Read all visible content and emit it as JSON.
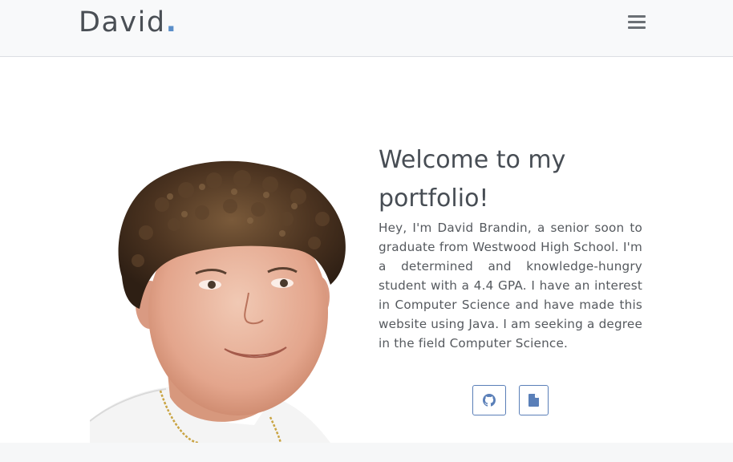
{
  "navbar": {
    "brand_name": "David",
    "brand_dot": ".",
    "menu_icon": "hamburger-icon"
  },
  "hero": {
    "photo_alt": "Portrait photo of David",
    "title": "Welcome to my portfolio!",
    "bio": "Hey, I'm David Brandin, a senior soon to graduate from Westwood High School. I'm a determined and knowledge-hungry student with a 4.4 GPA. I have an interest in Computer Science and have made this website using Java. I am seeking a degree in the field Computer Science.",
    "buttons": [
      {
        "icon": "github-icon"
      },
      {
        "icon": "document-icon"
      }
    ]
  },
  "colors": {
    "accent": "#5b8fc9",
    "button_border": "#5a7fb8",
    "text": "#444b52",
    "navbar_bg": "#f8f9fa"
  }
}
